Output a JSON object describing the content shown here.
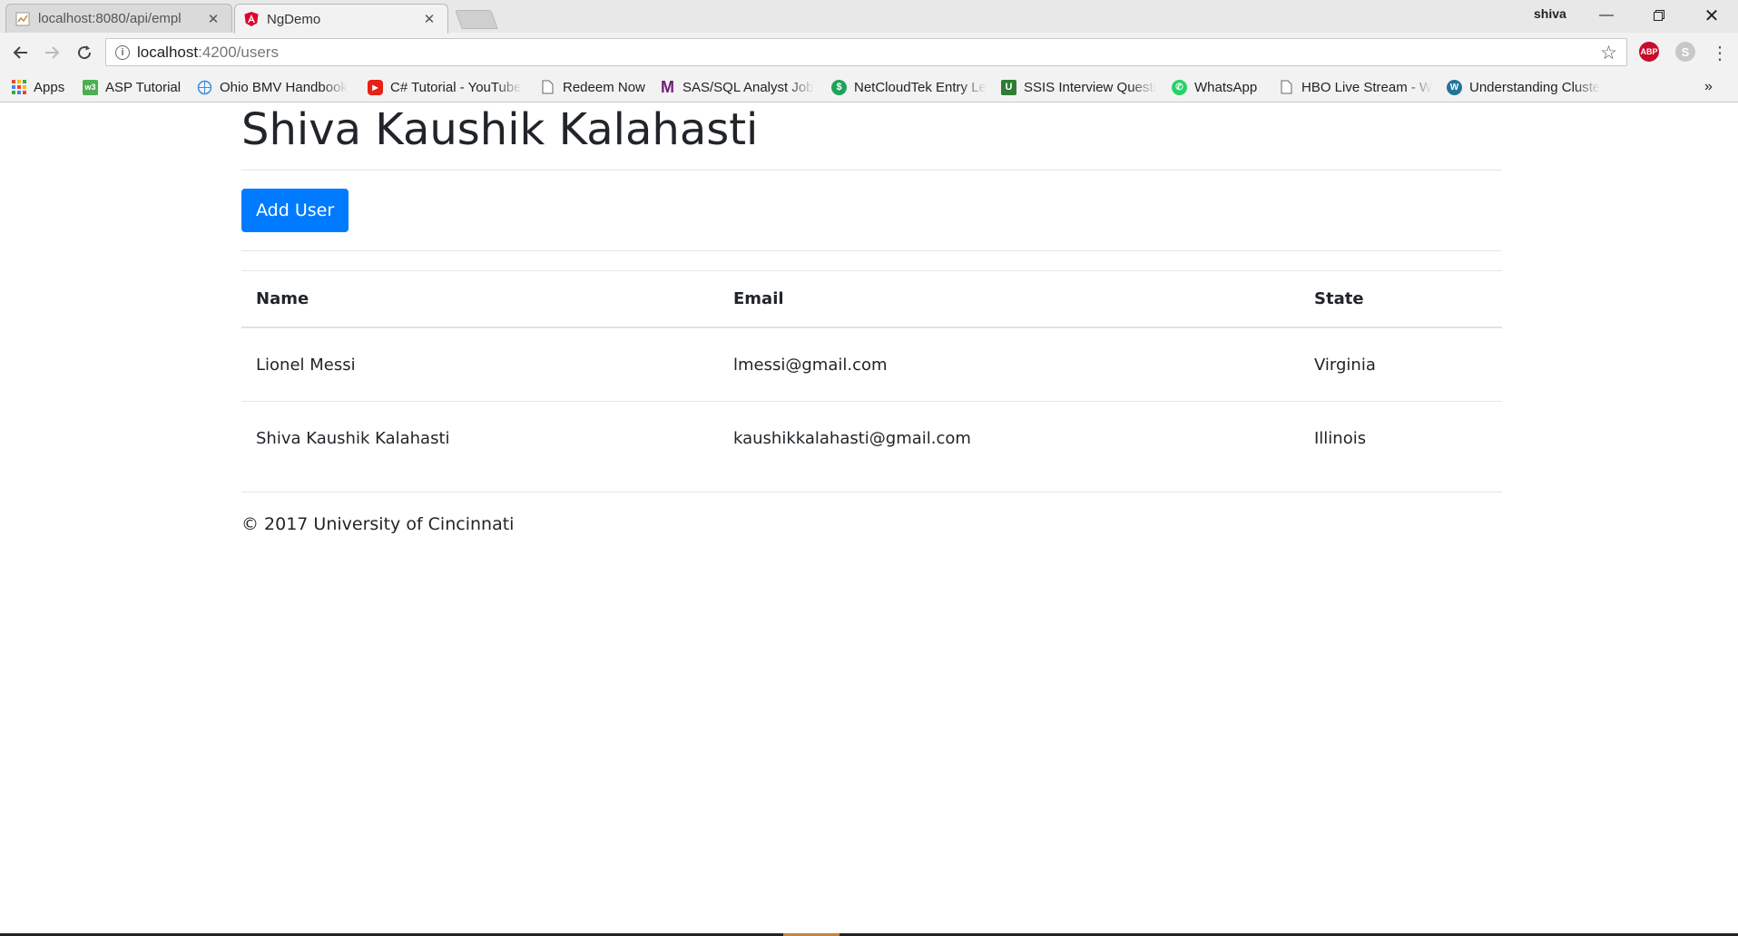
{
  "browser": {
    "tabs": [
      {
        "title": "localhost:8080/api/empl",
        "icon": "document-icon",
        "active": false
      },
      {
        "title": "NgDemo",
        "icon": "angular-icon",
        "active": true
      }
    ],
    "profile_name": "shiva",
    "url_host": "localhost",
    "url_path": ":4200/users",
    "bookmarks": [
      {
        "label": "Apps",
        "icon": "apps-grid-icon"
      },
      {
        "label": "ASP Tutorial",
        "icon": "w3-icon"
      },
      {
        "label": "Ohio BMV Handbook",
        "icon": "globe-icon"
      },
      {
        "label": "C# Tutorial - YouTube",
        "icon": "youtube-icon"
      },
      {
        "label": "Redeem Now",
        "icon": "page-icon"
      },
      {
        "label": "SAS/SQL Analyst Job",
        "icon": "m-icon"
      },
      {
        "label": "NetCloudTek Entry Le",
        "icon": "dollar-icon"
      },
      {
        "label": "SSIS Interview Questi",
        "icon": "u-icon"
      },
      {
        "label": "WhatsApp",
        "icon": "whatsapp-icon"
      },
      {
        "label": "HBO Live Stream - W",
        "icon": "page-icon"
      },
      {
        "label": "Understanding Cluste",
        "icon": "wordpress-icon"
      }
    ],
    "overflow_label": "»",
    "extensions": {
      "abp": "ABP",
      "skype": "S"
    }
  },
  "page": {
    "title": "Shiva Kaushik Kalahasti",
    "add_button_label": "Add User",
    "table": {
      "headers": {
        "name": "Name",
        "email": "Email",
        "state": "State"
      },
      "rows": [
        {
          "name": "Lionel Messi",
          "email": "lmessi@gmail.com",
          "state": "Virginia"
        },
        {
          "name": "Shiva Kaushik Kalahasti",
          "email": "kaushikkalahasti@gmail.com",
          "state": "Illinois"
        }
      ]
    },
    "footer": "© 2017 University of Cincinnati"
  },
  "colors": {
    "primary_button": "#007bff",
    "angular_red": "#dd0031",
    "abp_red": "#c70d2c"
  }
}
